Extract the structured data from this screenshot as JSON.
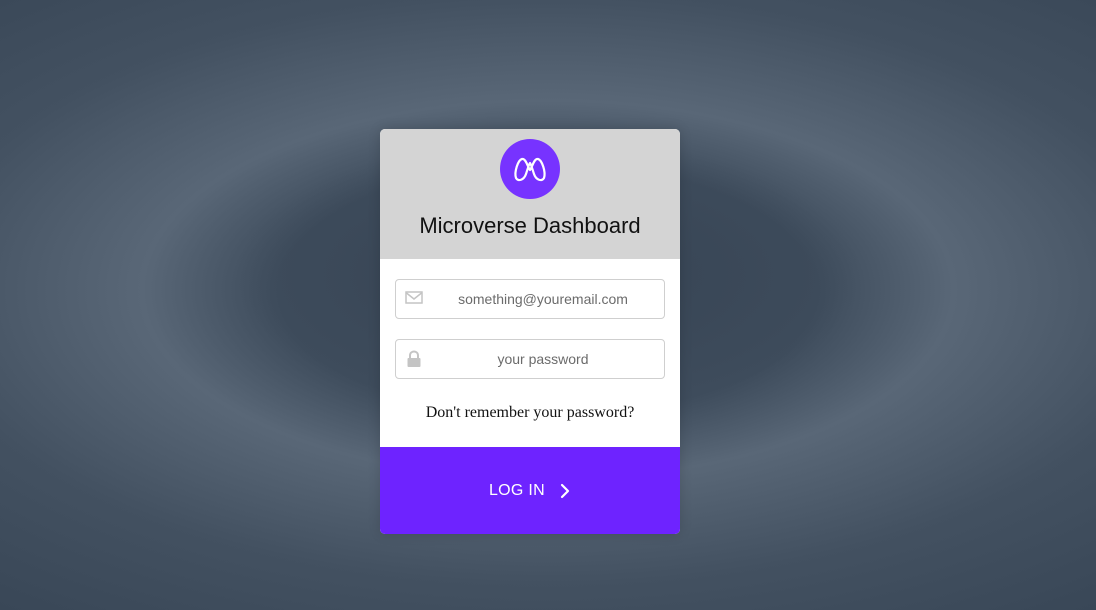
{
  "card": {
    "title": "Microverse Dashboard",
    "logo_icon": "microverse-logo-icon",
    "brand_color": "#7733ff"
  },
  "email": {
    "placeholder": "something@youremail.com",
    "value": "",
    "icon": "envelope-icon"
  },
  "password": {
    "placeholder": "your password",
    "value": "",
    "icon": "lock-icon"
  },
  "forgot_link": "Don't remember your password?",
  "login_button": {
    "label": "LOG IN",
    "icon": "chevron-right-icon",
    "color": "#6e23ff"
  }
}
